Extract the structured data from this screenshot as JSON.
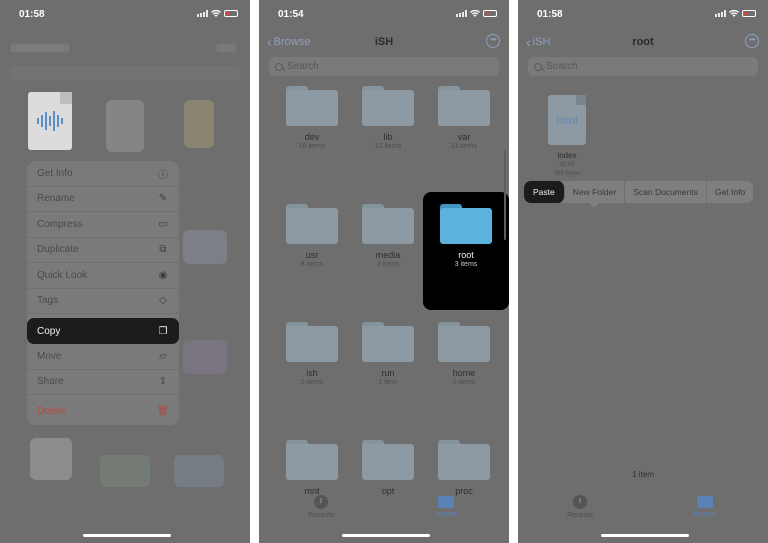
{
  "panel1": {
    "status": {
      "time": "01:58"
    },
    "menu": [
      {
        "label": "Get Info",
        "icon": "info-icon"
      },
      {
        "label": "Rename",
        "icon": "pencil-icon"
      },
      {
        "label": "Compress",
        "icon": "archive-box-icon"
      },
      {
        "label": "Duplicate",
        "icon": "duplicate-icon"
      },
      {
        "label": "Quick Look",
        "icon": "eye-icon"
      },
      {
        "label": "Tags",
        "icon": "tag-icon"
      },
      {
        "label": "Copy",
        "icon": "copy-doc-icon",
        "highlighted": true
      },
      {
        "label": "Move",
        "icon": "folder-icon"
      },
      {
        "label": "Share",
        "icon": "share-icon"
      },
      {
        "label": "Delete",
        "icon": "trash-icon",
        "destructive": true
      }
    ]
  },
  "panel2": {
    "status": {
      "time": "01:54"
    },
    "nav": {
      "back_label": "Browse",
      "title": "iSH",
      "more_icon": "ellipsis-circle-icon"
    },
    "search": {
      "placeholder": "Search"
    },
    "folders": [
      {
        "name": "dev",
        "count": "18 items"
      },
      {
        "name": "lib",
        "count": "12 items"
      },
      {
        "name": "var",
        "count": "11 items"
      },
      {
        "name": "usr",
        "count": "8 items"
      },
      {
        "name": "media",
        "count": "3 items"
      },
      {
        "name": "root",
        "count": "3 items",
        "selected": true
      },
      {
        "name": "ish",
        "count": "2 items"
      },
      {
        "name": "run",
        "count": "1 item"
      },
      {
        "name": "home",
        "count": "0 items"
      },
      {
        "name": "mnt",
        "count": ""
      },
      {
        "name": "opt",
        "count": ""
      },
      {
        "name": "proc",
        "count": ""
      }
    ],
    "tabbar": {
      "recents": "Recents",
      "browse": "Browse"
    }
  },
  "panel3": {
    "status": {
      "time": "01:58"
    },
    "nav": {
      "back_label": "iSH",
      "title": "root"
    },
    "search": {
      "placeholder": "Search"
    },
    "file": {
      "thumb_text": "html",
      "name": "index",
      "time": "01:55",
      "size": "365 bytes"
    },
    "context_menu": [
      "Paste",
      "New Folder",
      "Scan Documents",
      "Get Info"
    ],
    "item_count": "1 item",
    "tabbar": {
      "recents": "Recents",
      "browse": "Browse"
    }
  },
  "colors": {
    "dim_bg": "#6e6e6e",
    "highlight": "#1c1c1c",
    "folder_selected": "#5bb3dc",
    "accent": "#5b82b5"
  }
}
